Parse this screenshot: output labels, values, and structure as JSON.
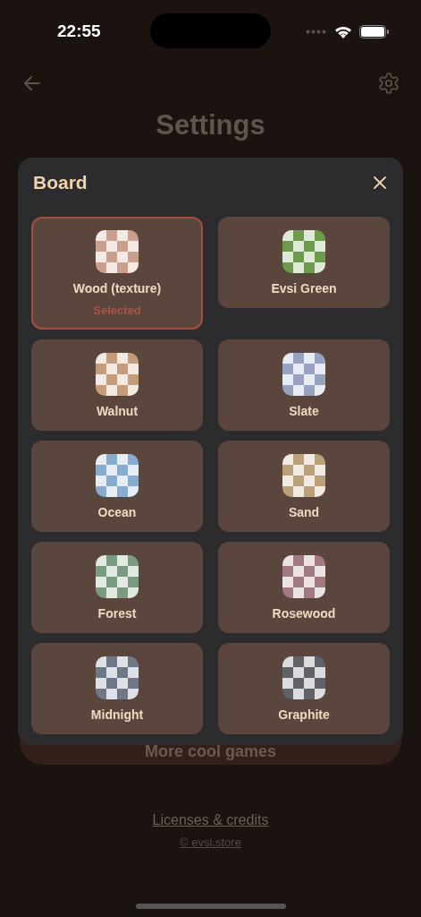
{
  "status_bar": {
    "time": "22:55"
  },
  "header": {
    "title": "Settings"
  },
  "more_button": {
    "label": "More cool games"
  },
  "footer": {
    "licenses": "Licenses & credits",
    "copyright": "© evsi.store"
  },
  "modal": {
    "title": "Board",
    "boards": [
      {
        "name": "Wood (texture)",
        "selected": true,
        "badge": "Selected",
        "color": "#c99f8e"
      },
      {
        "name": "Evsi Green",
        "selected": false,
        "color": "#6e9a4e"
      },
      {
        "name": "Walnut",
        "selected": false,
        "color": "#c49c7c"
      },
      {
        "name": "Slate",
        "selected": false,
        "color": "#96a2bf"
      },
      {
        "name": "Ocean",
        "selected": false,
        "color": "#88acd0"
      },
      {
        "name": "Sand",
        "selected": false,
        "color": "#bba17a"
      },
      {
        "name": "Forest",
        "selected": false,
        "color": "#7b9b80"
      },
      {
        "name": "Rosewood",
        "selected": false,
        "color": "#a07a80"
      },
      {
        "name": "Midnight",
        "selected": false,
        "color": "#6e7888"
      },
      {
        "name": "Graphite",
        "selected": false,
        "color": "#5f6268"
      }
    ]
  }
}
